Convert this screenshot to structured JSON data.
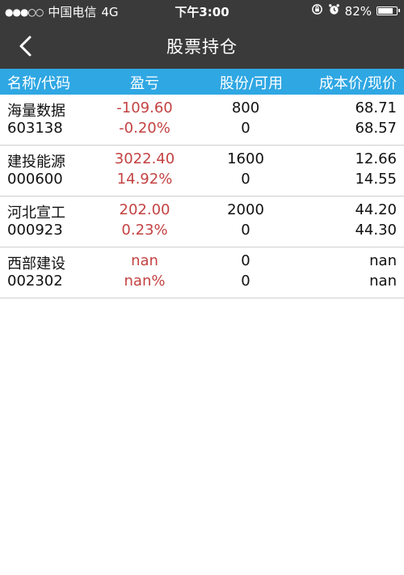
{
  "status_bar": {
    "signal": "●●●○○",
    "carrier": "中国电信",
    "network": "4G",
    "time": "下午3:00",
    "battery_text": "82%",
    "battery_level": 0.82
  },
  "nav": {
    "title": "股票持仓"
  },
  "table_header": {
    "name_code": "名称/代码",
    "pnl": "盈亏",
    "shares_avail": "股份/可用",
    "cost_price": "成本价/现价"
  },
  "holdings": [
    {
      "name": "海量数据",
      "code": "603138",
      "pnl": "-109.60",
      "pct": "-0.20%",
      "shares": "800",
      "avail": "0",
      "cost": "68.71",
      "price": "68.57"
    },
    {
      "name": "建投能源",
      "code": "000600",
      "pnl": "3022.40",
      "pct": "14.92%",
      "shares": "1600",
      "avail": "0",
      "cost": "12.66",
      "price": "14.55"
    },
    {
      "name": "河北宣工",
      "code": "000923",
      "pnl": "202.00",
      "pct": "0.23%",
      "shares": "2000",
      "avail": "0",
      "cost": "44.20",
      "price": "44.30"
    },
    {
      "name": "西部建设",
      "code": "002302",
      "pnl": "nan",
      "pct": "nan%",
      "shares": "0",
      "avail": "0",
      "cost": "nan",
      "price": "nan"
    }
  ],
  "colors": {
    "bar_bg": "#3a3a3a",
    "header_bg": "#2fa7e3",
    "pnl_text": "#c44242"
  }
}
